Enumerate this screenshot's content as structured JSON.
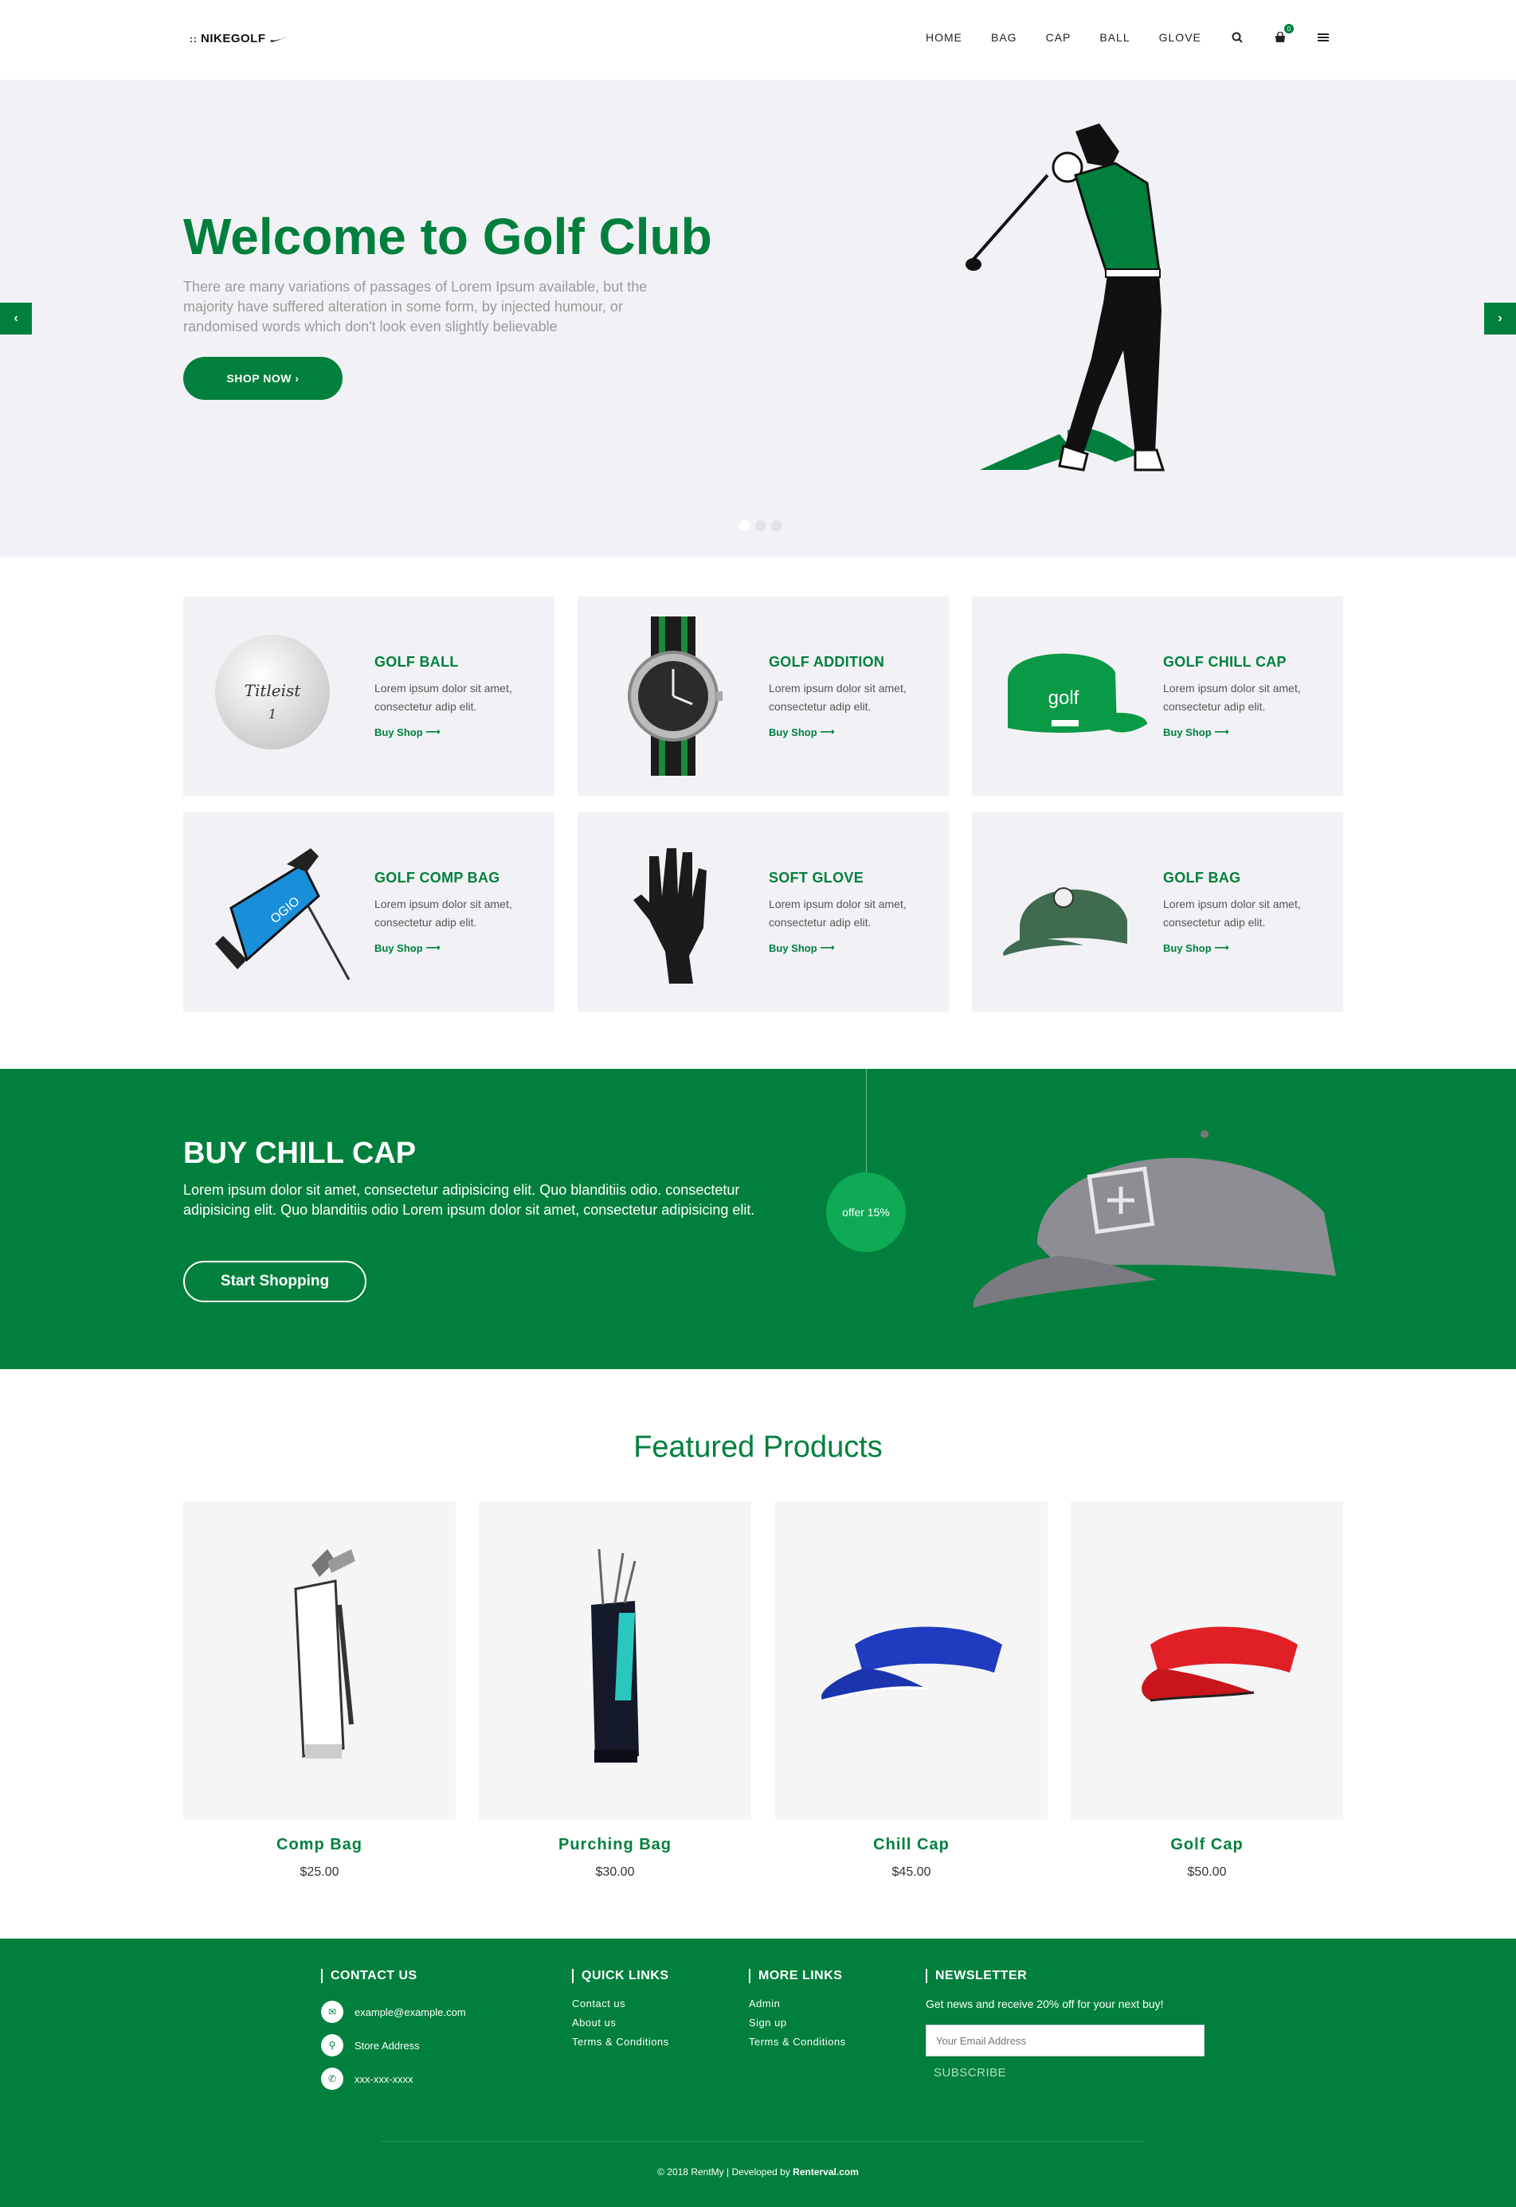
{
  "header": {
    "logo_text": "NIKEGOLF",
    "logo_dots": "::",
    "nav": [
      "HOME",
      "BAG",
      "CAP",
      "BALL",
      "GLOVE"
    ],
    "cart_count": "0",
    "icons": [
      "search-icon",
      "cart-icon",
      "menu-icon"
    ]
  },
  "hero": {
    "title": "Welcome to Golf Club",
    "description": "There are many variations of passages of Lorem Ipsum available, but the majority have suffered alteration in some form, by injected humour, or randomised words which don't look even slightly believable",
    "button": "SHOP NOW  ›",
    "prev": "‹",
    "next": "›",
    "slides": 3,
    "active_slide": 1
  },
  "categories": [
    {
      "title": "GOLF BALL",
      "desc": "Lorem ipsum dolor sit amet, consectetur adip elit.",
      "link": "Buy Shop",
      "icon": "golf-ball"
    },
    {
      "title": "GOLF ADDITION",
      "desc": "Lorem ipsum dolor sit amet, consectetur adip elit.",
      "link": "Buy Shop",
      "icon": "watch"
    },
    {
      "title": "GOLF CHILL CAP",
      "desc": "Lorem ipsum dolor sit amet, consectetur adip elit.",
      "link": "Buy Shop",
      "icon": "green-cap",
      "cap_text": "golf"
    },
    {
      "title": "GOLF COMP BAG",
      "desc": "Lorem ipsum dolor sit amet, consectetur adip elit.",
      "link": "Buy Shop",
      "icon": "blue-bag"
    },
    {
      "title": "SOFT GLOVE",
      "desc": "Lorem ipsum dolor sit amet, consectetur adip elit.",
      "link": "Buy Shop",
      "icon": "glove"
    },
    {
      "title": "GOLF BAG",
      "desc": "Lorem ipsum dolor sit amet, consectetur adip elit.",
      "link": "Buy Shop",
      "icon": "green-baseball-cap"
    }
  ],
  "promo": {
    "title": "BUY CHILL CAP",
    "description": "Lorem ipsum dolor sit amet, consectetur adipisicing elit. Quo blanditiis odio. consectetur adipisicing elit. Quo blanditiis odio Lorem ipsum dolor sit amet, consectetur adipisicing elit.",
    "button": "Start Shopping",
    "offer": "offer 15%"
  },
  "featured": {
    "title": "Featured Products",
    "prev": "‹",
    "next": "›",
    "products": [
      {
        "name": "Comp Bag",
        "price": "$25.00"
      },
      {
        "name": "Purching Bag",
        "price": "$30.00"
      },
      {
        "name": "Chill Cap",
        "price": "$45.00"
      },
      {
        "name": "Golf Cap",
        "price": "$50.00"
      }
    ]
  },
  "footer": {
    "contact": {
      "heading": "CONTACT US",
      "email": "example@example.com",
      "address": "Store Address",
      "phone": "xxx-xxx-xxxx"
    },
    "quick_links": {
      "heading": "QUICK LINKS",
      "items": [
        "Contact us",
        "About us",
        "Terms & Conditions"
      ]
    },
    "more_links": {
      "heading": "MORE LINKS",
      "items": [
        "Admin",
        "Sign up",
        "Terms & Conditions"
      ]
    },
    "newsletter": {
      "heading": "NEWSLETTER",
      "text": "Get news and receive 20% off for your next buy!",
      "placeholder": "Your Email Address",
      "button": "SUBSCRIBE"
    },
    "copyright_prefix": "© 2018 RentMy | Developed by ",
    "copyright_link": "Renterval.com"
  },
  "colors": {
    "brand_green": "#00803c",
    "offer_green": "#0eaa55",
    "panel_grey": "#f2f2f6"
  }
}
